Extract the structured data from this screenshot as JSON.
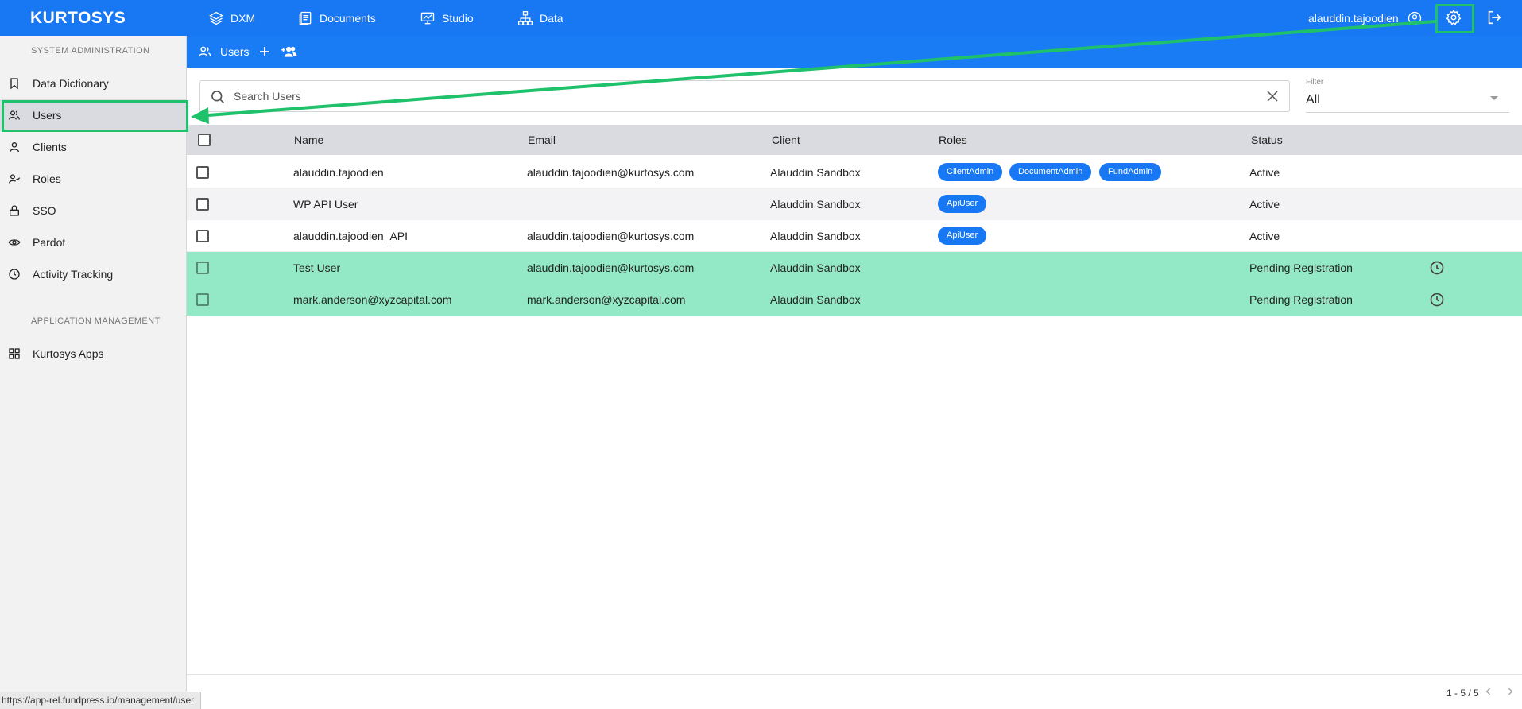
{
  "app": {
    "logo": "KURTOSYS",
    "username": "alauddin.tajoodien"
  },
  "topnav": [
    {
      "label": "DXM",
      "icon": "layers-icon"
    },
    {
      "label": "Documents",
      "icon": "documents-icon"
    },
    {
      "label": "Studio",
      "icon": "presentation-icon"
    },
    {
      "label": "Data",
      "icon": "hierarchy-icon"
    }
  ],
  "subheader": {
    "title": "Users"
  },
  "sidebar": {
    "section1": "SYSTEM ADMINISTRATION",
    "section2": "APPLICATION MANAGEMENT",
    "items": [
      {
        "label": "Data Dictionary",
        "icon": "bookmark-icon"
      },
      {
        "label": "Users",
        "icon": "users-icon"
      },
      {
        "label": "Clients",
        "icon": "person-icon"
      },
      {
        "label": "Roles",
        "icon": "user-check-icon"
      },
      {
        "label": "SSO",
        "icon": "lock-icon"
      },
      {
        "label": "Pardot",
        "icon": "eye-icon"
      },
      {
        "label": "Activity Tracking",
        "icon": "clock-icon"
      },
      {
        "label": "Kurtosys Apps",
        "icon": "grid-icon"
      }
    ]
  },
  "search": {
    "placeholder": "Search Users",
    "value": ""
  },
  "filter": {
    "label": "Filter",
    "value": "All"
  },
  "table": {
    "columns": [
      "Name",
      "Email",
      "Client",
      "Roles",
      "Status"
    ],
    "rows": [
      {
        "name": "alauddin.tajoodien",
        "email": "alauddin.tajoodien@kurtosys.com",
        "client": "Alauddin Sandbox",
        "roles": [
          "ClientAdmin",
          "DocumentAdmin",
          "FundAdmin"
        ],
        "status": "Active"
      },
      {
        "name": "WP API User",
        "email": "",
        "client": "Alauddin Sandbox",
        "roles": [
          "ApiUser"
        ],
        "status": "Active"
      },
      {
        "name": "alauddin.tajoodien_API",
        "email": "alauddin.tajoodien@kurtosys.com",
        "client": "Alauddin Sandbox",
        "roles": [
          "ApiUser"
        ],
        "status": "Active"
      },
      {
        "name": "Test User",
        "email": "alauddin.tajoodien@kurtosys.com",
        "client": "Alauddin Sandbox",
        "roles": [],
        "status": "Pending Registration"
      },
      {
        "name": "mark.anderson@xyzcapital.com",
        "email": "mark.anderson@xyzcapital.com",
        "client": "Alauddin Sandbox",
        "roles": [],
        "status": "Pending Registration"
      }
    ]
  },
  "pagination": {
    "text": "1 - 5 / 5"
  },
  "status_url": "https://app-rel.fundpress.io/management/user",
  "colors": {
    "brand": "#1877f2",
    "pending_row": "#93e9c6",
    "annotation": "#1fc16b"
  }
}
